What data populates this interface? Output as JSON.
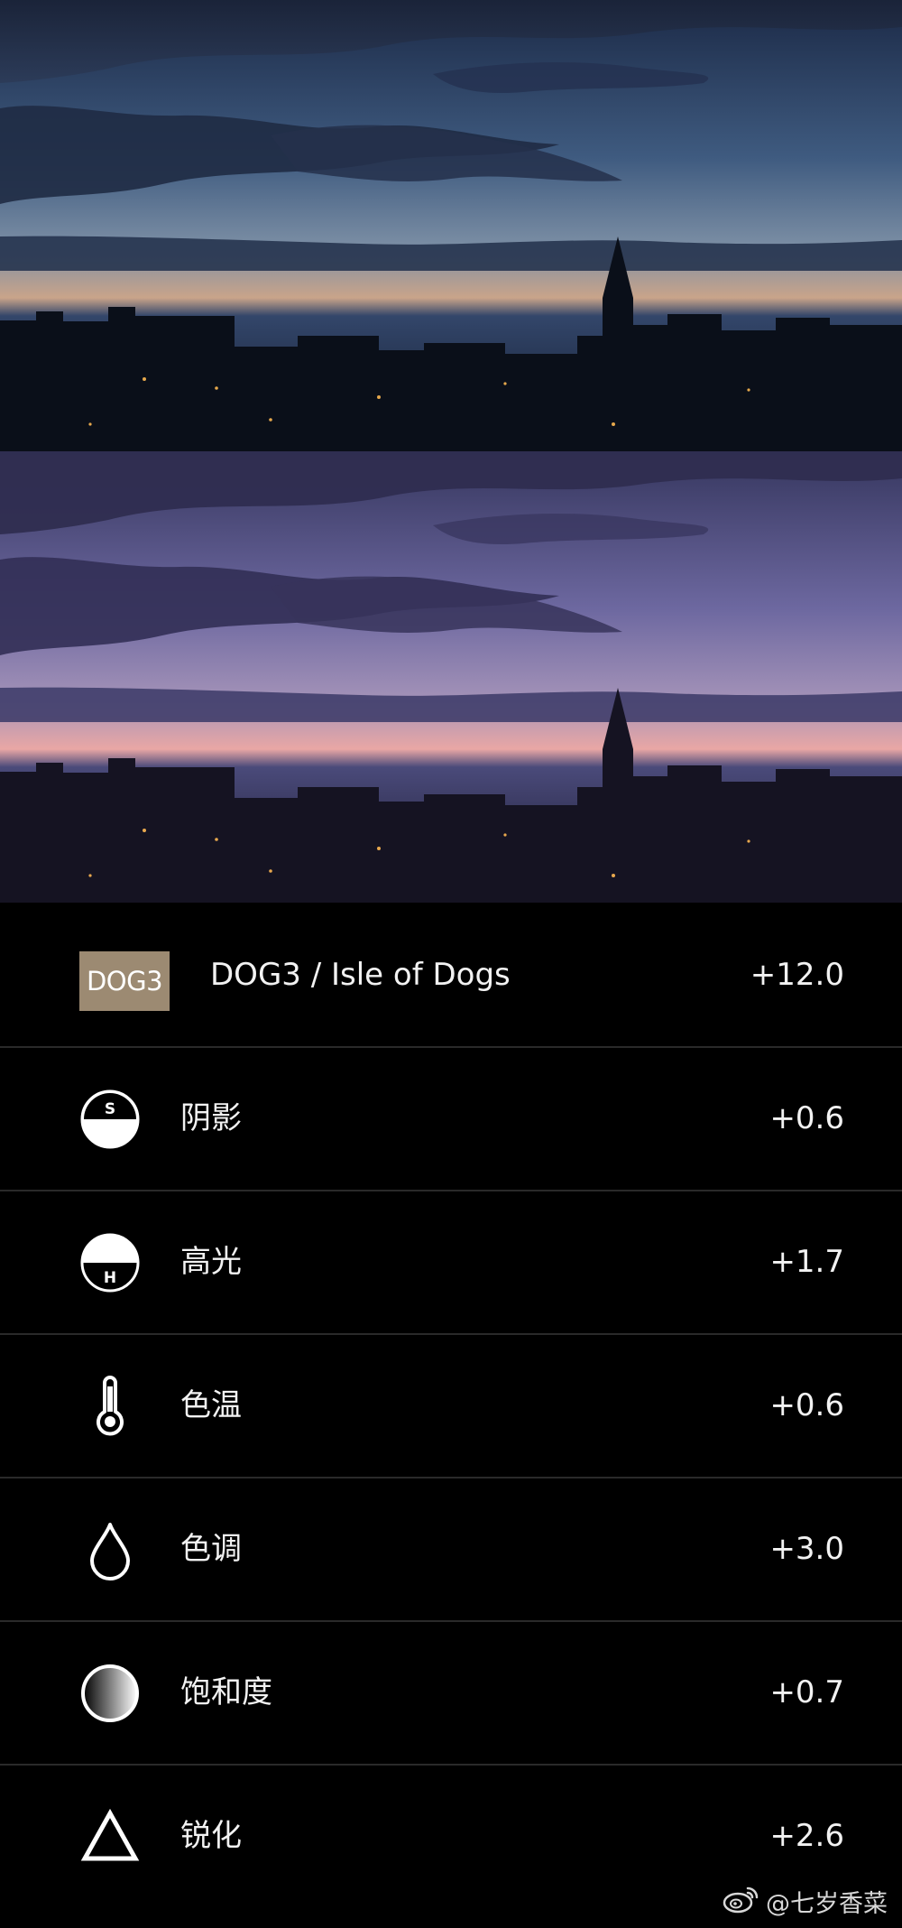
{
  "photos": {
    "before": {
      "sky_top": "#1d2b46",
      "sky_mid": "#4f6c8f",
      "sky_horizon": "#c9a48a"
    },
    "after": {
      "sky_top": "#3a3a66",
      "sky_mid": "#7a73a6",
      "sky_horizon": "#e9a7a5"
    }
  },
  "preset": {
    "badge": "DOG3",
    "name": "DOG3 / Isle of Dogs",
    "value": "+12.0",
    "badge_color": "#9c8a72"
  },
  "adjustments": [
    {
      "icon": "shadows-icon",
      "label": "阴影",
      "value": "+0.6"
    },
    {
      "icon": "highlights-icon",
      "label": "高光",
      "value": "+1.7"
    },
    {
      "icon": "temperature-icon",
      "label": "色温",
      "value": "+0.6"
    },
    {
      "icon": "tint-icon",
      "label": "色调",
      "value": "+3.0"
    },
    {
      "icon": "saturation-icon",
      "label": "饱和度",
      "value": "+0.7"
    },
    {
      "icon": "sharpen-icon",
      "label": "锐化",
      "value": "+2.6"
    }
  ],
  "watermark": {
    "text": "@七岁香菜",
    "icon": "weibo-icon"
  }
}
